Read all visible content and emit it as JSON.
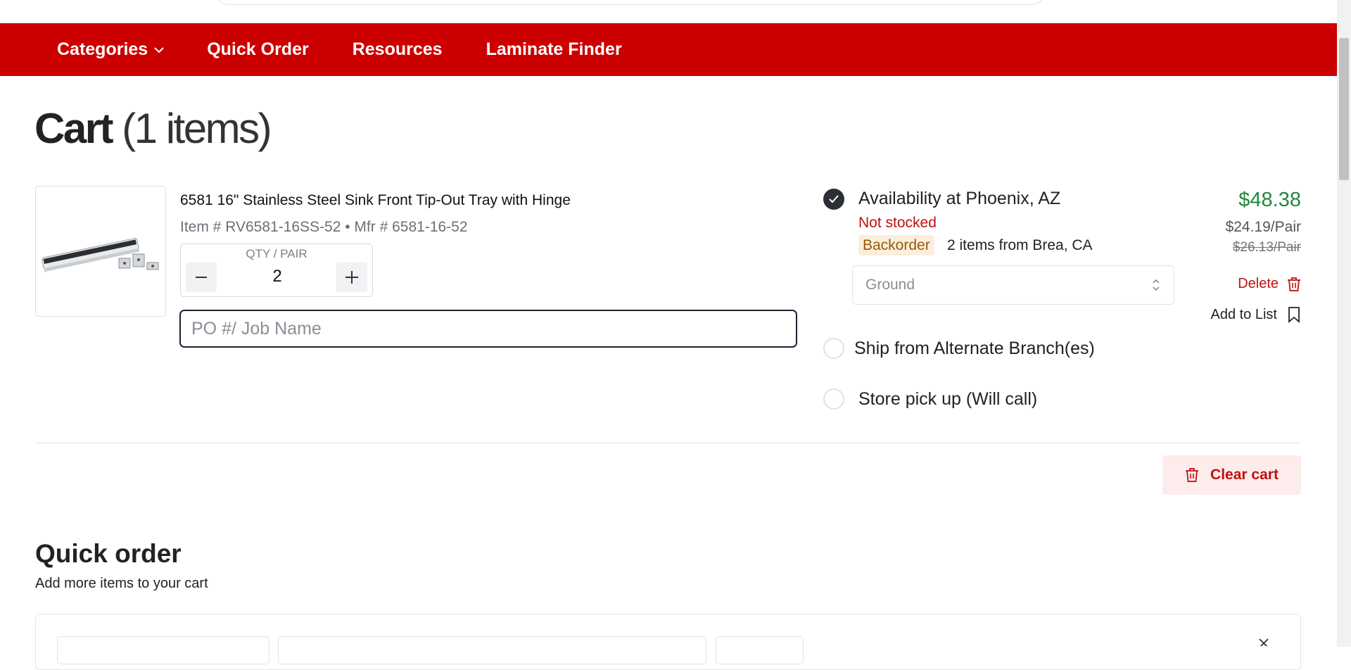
{
  "nav": {
    "items": [
      {
        "label": "Categories",
        "icon": "chevron-down-icon"
      },
      {
        "label": "Quick Order"
      },
      {
        "label": "Resources"
      },
      {
        "label": "Laminate Finder"
      }
    ],
    "bg_color": "#cc0000"
  },
  "cart": {
    "title": "Cart",
    "count_label": "(1 items)"
  },
  "item": {
    "image_alt": "Stainless steel sink tip-out tray",
    "name": "6581 16\" Stainless Steel Sink Front Tip-Out Tray with Hinge",
    "meta": "Item # RV6581-16SS-52 • Mfr # 6581-16-52",
    "qty_label": "QTY / PAIR",
    "qty": "2",
    "po_placeholder": "PO #/ Job Name",
    "price_total": "$48.38",
    "price_unit": "$24.19/Pair",
    "price_original": "$26.13/Pair",
    "delete_label": "Delete",
    "add_to_list_label": "Add to List"
  },
  "fulfillment": {
    "availability_title": "Availability at Phoenix, AZ",
    "stock_status": "Not stocked",
    "backorder_badge": "Backorder",
    "backorder_text": "2 items from Brea, CA",
    "shipping_method": "Ground",
    "alt_branch_label": "Ship from Alternate Branch(es)",
    "pickup_label": "Store pick up (Will call)",
    "selected_option": "availability"
  },
  "actions": {
    "clear_cart_label": "Clear cart"
  },
  "quick_order": {
    "title": "Quick order",
    "subtitle": "Add more items to your cart"
  },
  "colors": {
    "accent_red": "#cc0000",
    "price_green": "#1f8a3a",
    "error_red": "#c10f0f",
    "backorder_bg": "#fbeedd",
    "backorder_text": "#9a5a07"
  }
}
